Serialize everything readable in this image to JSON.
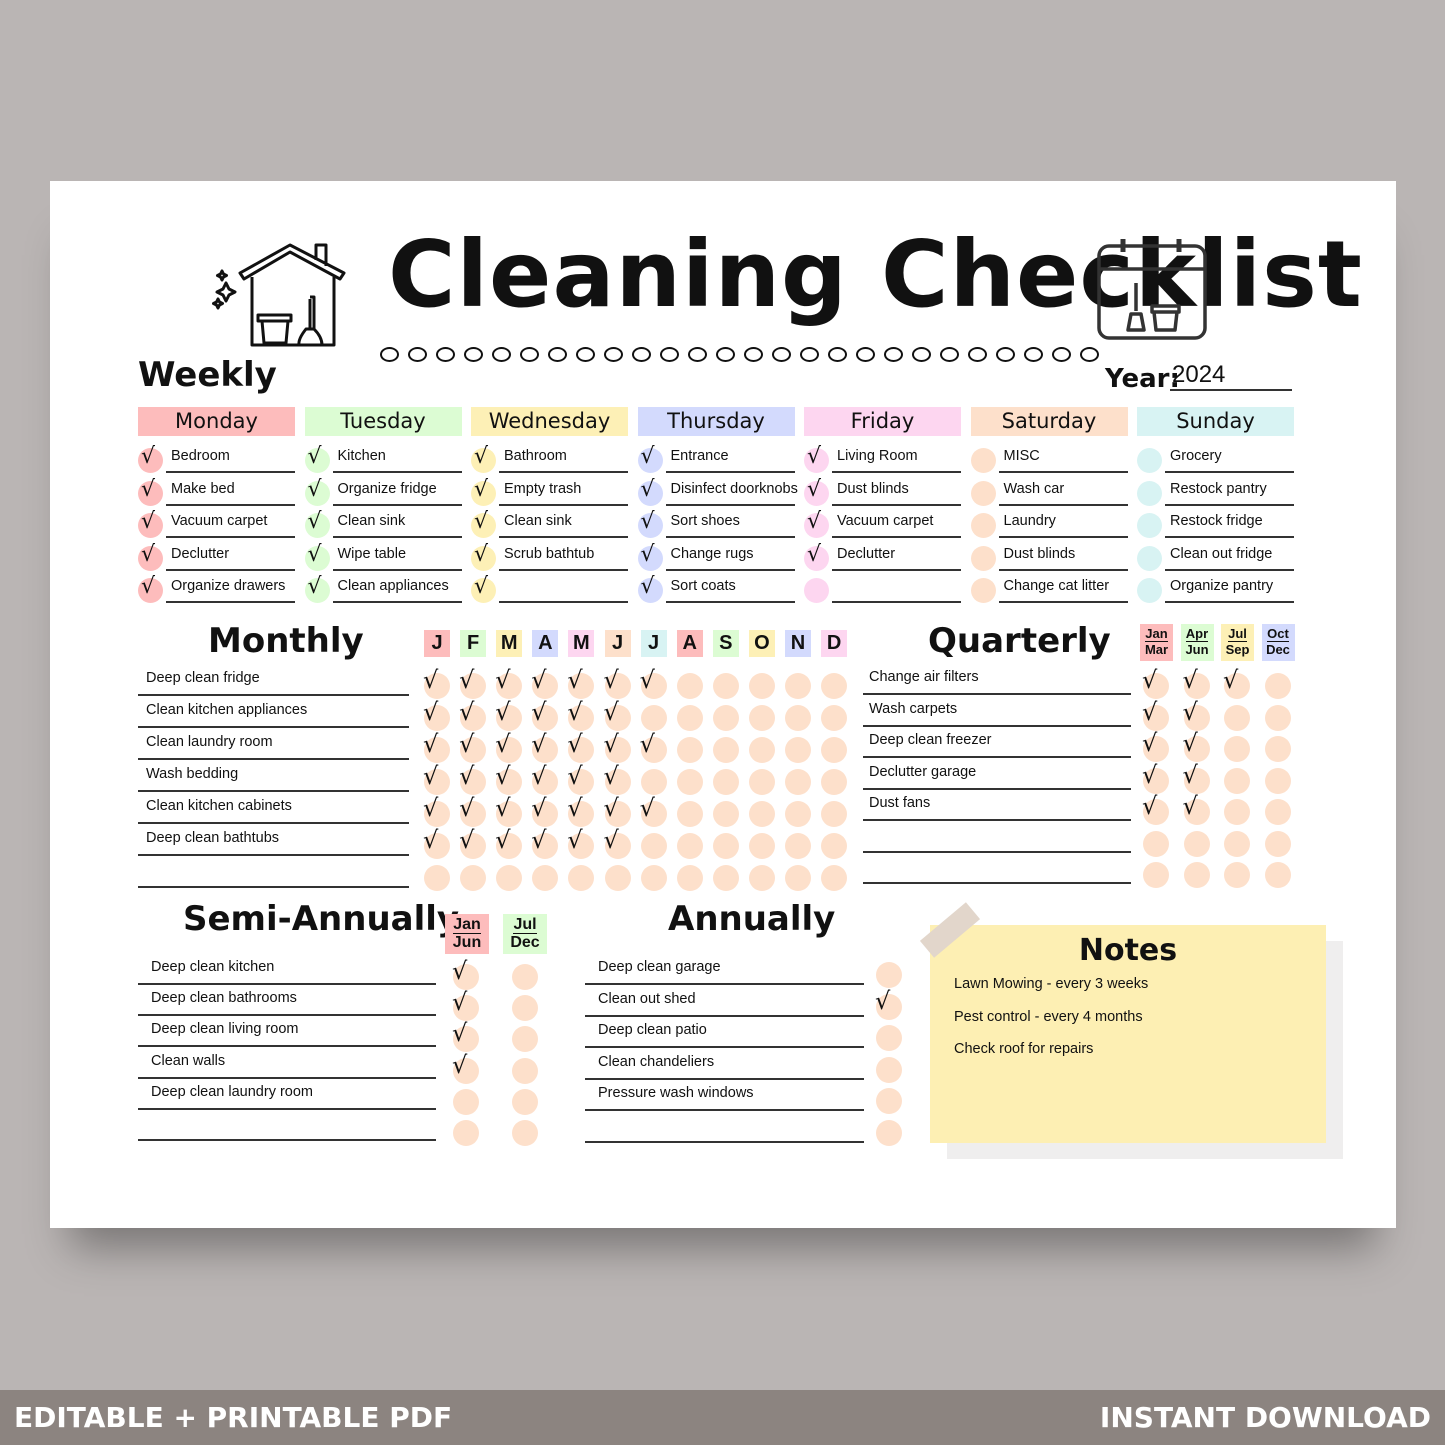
{
  "title": "Cleaning Checklist",
  "year": {
    "label": "Year:",
    "value": "2024"
  },
  "weekly": {
    "title": "Weekly",
    "days": [
      {
        "name": "Monday",
        "color": "#fdbcbc",
        "dot": "#fdbcbc",
        "tasks": [
          {
            "text": "Bedroom",
            "done": true
          },
          {
            "text": "Make bed",
            "done": true
          },
          {
            "text": "Vacuum carpet",
            "done": true
          },
          {
            "text": "Declutter",
            "done": true
          },
          {
            "text": "Organize drawers",
            "done": true
          }
        ]
      },
      {
        "name": "Tuesday",
        "color": "#dcfcd3",
        "dot": "#dcfcd3",
        "tasks": [
          {
            "text": "Kitchen",
            "done": true
          },
          {
            "text": "Organize fridge",
            "done": true
          },
          {
            "text": "Clean sink",
            "done": true
          },
          {
            "text": "Wipe table",
            "done": true
          },
          {
            "text": "Clean appliances",
            "done": true
          }
        ]
      },
      {
        "name": "Wednesday",
        "color": "#fdf0b6",
        "dot": "#fdf0b6",
        "tasks": [
          {
            "text": "Bathroom",
            "done": true
          },
          {
            "text": "Empty trash",
            "done": true
          },
          {
            "text": "Clean sink",
            "done": true
          },
          {
            "text": "Scrub bathtub",
            "done": true
          },
          {
            "text": "",
            "done": true
          }
        ]
      },
      {
        "name": "Thursday",
        "color": "#d3dafd",
        "dot": "#d3dafd",
        "tasks": [
          {
            "text": "Entrance",
            "done": true
          },
          {
            "text": "Disinfect doorknobs",
            "done": true
          },
          {
            "text": "Sort shoes",
            "done": true
          },
          {
            "text": "Change rugs",
            "done": true
          },
          {
            "text": "Sort coats",
            "done": true
          }
        ]
      },
      {
        "name": "Friday",
        "color": "#fdd6f0",
        "dot": "#fdd6f0",
        "tasks": [
          {
            "text": "Living Room",
            "done": true
          },
          {
            "text": "Dust blinds",
            "done": true
          },
          {
            "text": "Vacuum carpet",
            "done": true
          },
          {
            "text": "Declutter",
            "done": true
          },
          {
            "text": "",
            "done": false
          }
        ]
      },
      {
        "name": "Saturday",
        "color": "#fde0cb",
        "dot": "#fde0cb",
        "tasks": [
          {
            "text": "MISC",
            "done": false
          },
          {
            "text": "Wash car",
            "done": false
          },
          {
            "text": "Laundry",
            "done": false
          },
          {
            "text": "Dust blinds",
            "done": false
          },
          {
            "text": "Change cat litter",
            "done": false
          }
        ]
      },
      {
        "name": "Sunday",
        "color": "#d8f3f3",
        "dot": "#d8f3f3",
        "tasks": [
          {
            "text": "Grocery",
            "done": false
          },
          {
            "text": "Restock pantry",
            "done": false
          },
          {
            "text": "Restock fridge",
            "done": false
          },
          {
            "text": "Clean out fridge",
            "done": false
          },
          {
            "text": "Organize pantry",
            "done": false
          }
        ]
      }
    ]
  },
  "monthly": {
    "title": "Monthly",
    "months": [
      {
        "l": "J",
        "c": "#fdbcbc"
      },
      {
        "l": "F",
        "c": "#dcfcd3"
      },
      {
        "l": "M",
        "c": "#fdf0b6"
      },
      {
        "l": "A",
        "c": "#d3dafd"
      },
      {
        "l": "M",
        "c": "#fdd6f0"
      },
      {
        "l": "J",
        "c": "#fde0cb"
      },
      {
        "l": "J",
        "c": "#d8f3f3"
      },
      {
        "l": "A",
        "c": "#fdbcbc"
      },
      {
        "l": "S",
        "c": "#dcfcd3"
      },
      {
        "l": "O",
        "c": "#fdf0b6"
      },
      {
        "l": "N",
        "c": "#d3dafd"
      },
      {
        "l": "D",
        "c": "#fdd6f0"
      }
    ],
    "rows": [
      {
        "text": "Deep clean fridge",
        "done": 7
      },
      {
        "text": "Clean kitchen appliances",
        "done": 6
      },
      {
        "text": "Clean laundry room",
        "done": 7
      },
      {
        "text": "Wash bedding",
        "done": 6
      },
      {
        "text": "Clean kitchen cabinets",
        "done": 7
      },
      {
        "text": "Deep clean bathtubs",
        "done": 6
      },
      {
        "text": "",
        "done": 0
      }
    ]
  },
  "quarterly": {
    "title": "Quarterly",
    "quarters": [
      {
        "a": "Jan",
        "b": "Mar",
        "c": "#fdbcbc"
      },
      {
        "a": "Apr",
        "b": "Jun",
        "c": "#dcfcd3"
      },
      {
        "a": "Jul",
        "b": "Sep",
        "c": "#fdf0b6"
      },
      {
        "a": "Oct",
        "b": "Dec",
        "c": "#d3dafd"
      }
    ],
    "rows": [
      {
        "text": "Change air filters",
        "done": 3
      },
      {
        "text": "Wash carpets",
        "done": 2
      },
      {
        "text": "Deep clean freezer",
        "done": 2
      },
      {
        "text": "Declutter garage",
        "done": 2
      },
      {
        "text": "Dust fans",
        "done": 2
      },
      {
        "text": "",
        "done": 0
      },
      {
        "text": "",
        "done": 0
      }
    ]
  },
  "semi": {
    "title": "Semi-Annually",
    "halves": [
      {
        "a": "Jan",
        "b": "Jun",
        "c": "#fdbcbc"
      },
      {
        "a": "Jul",
        "b": "Dec",
        "c": "#dcfcd3"
      }
    ],
    "rows": [
      {
        "text": "Deep clean kitchen",
        "done": 1
      },
      {
        "text": "Deep clean bathrooms",
        "done": 1
      },
      {
        "text": "Deep clean living room",
        "done": 1
      },
      {
        "text": "Clean walls",
        "done": 1
      },
      {
        "text": "Deep clean laundry room",
        "done": 0
      },
      {
        "text": "",
        "done": 0
      }
    ]
  },
  "annually": {
    "title": "Annually",
    "rows": [
      {
        "text": "Deep clean garage",
        "done": false
      },
      {
        "text": "Clean out shed",
        "done": true
      },
      {
        "text": "Deep clean patio",
        "done": false
      },
      {
        "text": "Clean chandeliers",
        "done": false
      },
      {
        "text": "Pressure wash windows",
        "done": false
      },
      {
        "text": "",
        "done": false
      }
    ]
  },
  "notes": {
    "title": "Notes",
    "lines": [
      "Lawn Mowing - every 3 weeks",
      "Pest control - every 4 months",
      "Check roof for repairs"
    ]
  },
  "banner": {
    "left": "EDITABLE + PRINTABLE PDF",
    "right": "INSTANT DOWNLOAD"
  },
  "check_glyph": "√",
  "icons": {
    "house": "house-cleaning-icon",
    "calendar": "calendar-cleaning-icon"
  }
}
